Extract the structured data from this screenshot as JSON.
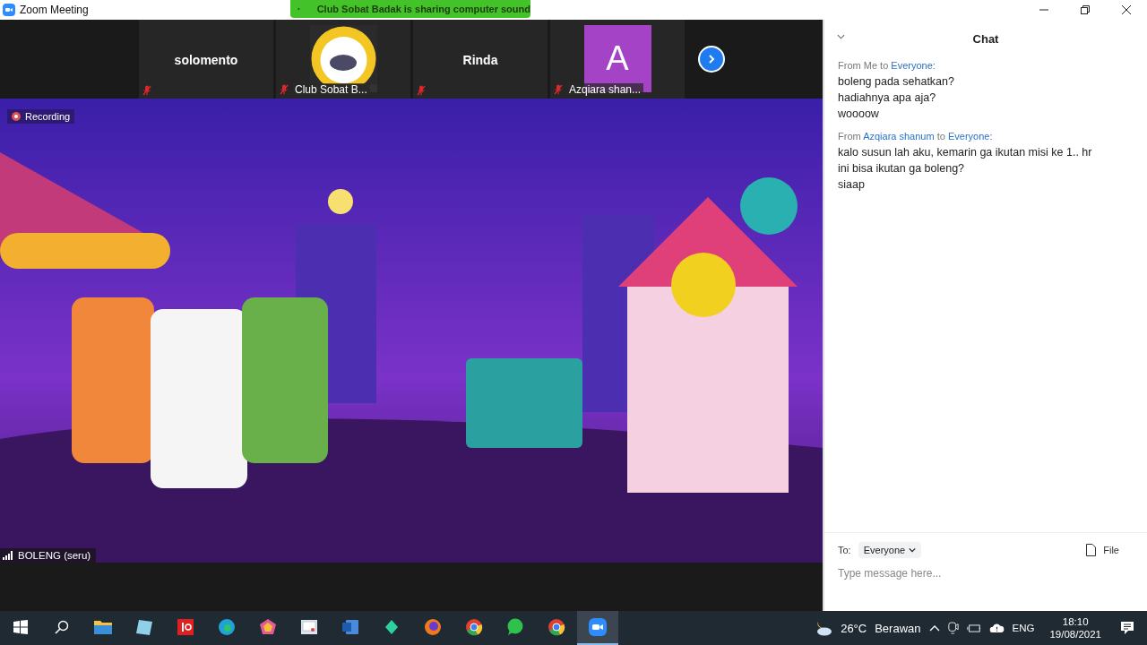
{
  "window": {
    "title": "Zoom Meeting"
  },
  "sharing_banner": {
    "text": "Club Sobat Badak is sharing computer sound"
  },
  "participants": [
    {
      "kind": "name",
      "name": "solomento",
      "muted": true
    },
    {
      "kind": "video",
      "label": "Club Sobat B...",
      "muted": true
    },
    {
      "kind": "name",
      "name": "Rinda",
      "muted": true
    },
    {
      "kind": "avatar",
      "avatar": "A",
      "label": "Azqiara shan...",
      "muted": true
    }
  ],
  "video": {
    "recording": "Recording",
    "speaker": "BOLENG (seru)"
  },
  "chat": {
    "title": "Chat",
    "messages": [
      {
        "header": [
          {
            "text": "From ",
            "kind": "plain"
          },
          {
            "text": "Me",
            "kind": "plain"
          },
          {
            "text": " to ",
            "kind": "plain"
          },
          {
            "text": "Everyone:",
            "kind": "name"
          }
        ],
        "lines": [
          "boleng pada sehatkan?",
          "hadiahnya apa aja?",
          "woooow"
        ]
      },
      {
        "header": [
          {
            "text": "From ",
            "kind": "plain"
          },
          {
            "text": "Azqiara shanum",
            "kind": "name"
          },
          {
            "text": " to ",
            "kind": "plain"
          },
          {
            "text": "Everyone:",
            "kind": "name"
          }
        ],
        "lines": [
          "kalo susun lah aku, kemarin ga ikutan misi ke 1.. hr ini bisa ikutan ga boleng?",
          "siaap"
        ]
      }
    ],
    "to_label": "To:",
    "recipient": "Everyone",
    "file_button": "File",
    "input": {
      "placeholder": "Type message here..."
    }
  },
  "taskbar": {
    "apps": [
      {
        "selected": false
      },
      {
        "selected": false
      },
      {
        "selected": false
      },
      {
        "selected": false
      },
      {
        "selected": false
      },
      {
        "selected": false
      },
      {
        "selected": false
      },
      {
        "selected": false
      },
      {
        "selected": false
      },
      {
        "selected": false
      },
      {
        "selected": false
      },
      {
        "selected": false
      },
      {
        "selected": true
      }
    ],
    "weather": {
      "temperature": "26°C",
      "condition": "Berawan"
    },
    "language": "ENG",
    "time": "18:10",
    "date": "19/08/2021"
  }
}
